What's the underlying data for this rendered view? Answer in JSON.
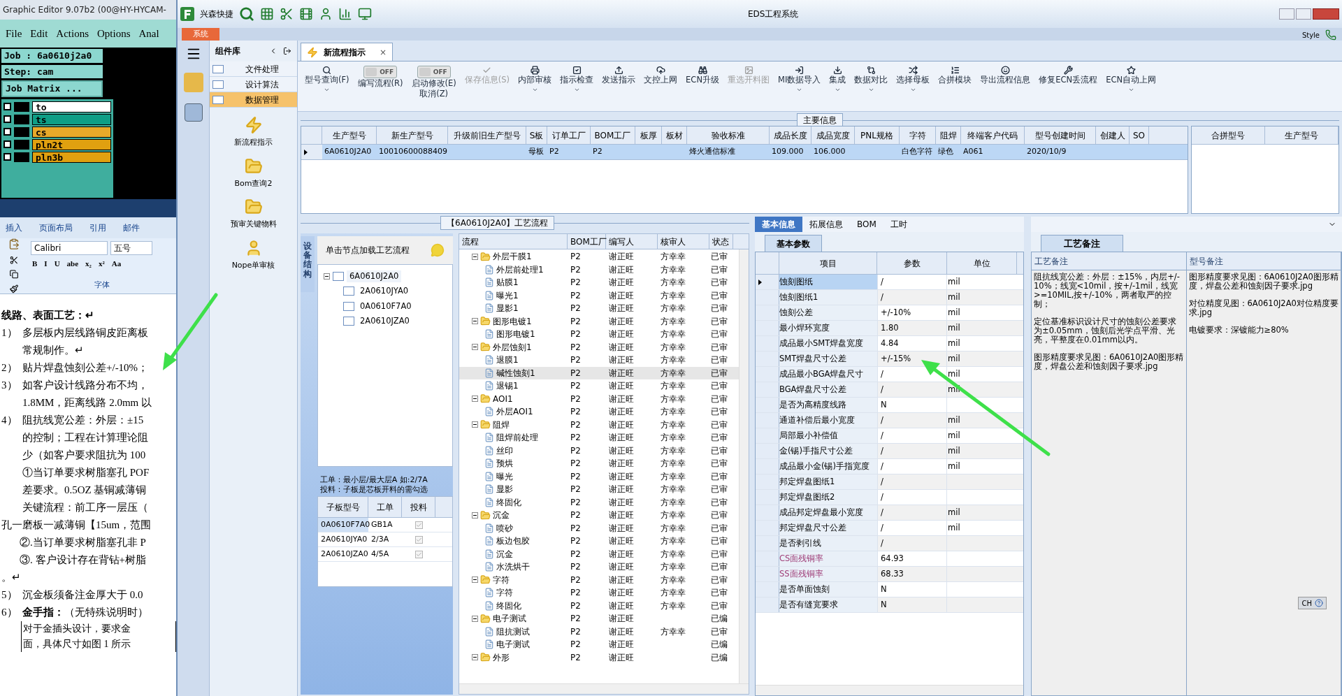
{
  "graphic_editor": {
    "title": "Graphic Editor 9.07b2 (00@HY-HYCAM-",
    "menu": [
      "File",
      "Edit",
      "Actions",
      "Options",
      "Anal"
    ],
    "job": "Job : 6a0610j2a0",
    "step": "Step: cam",
    "matrix_button": "Job Matrix ...",
    "layers": [
      {
        "name": "to",
        "color": "#ffffff",
        "checked": false
      },
      {
        "name": "ts",
        "color": "#0f9e86",
        "checked": false
      },
      {
        "name": "cs",
        "color": "#e8a92a",
        "checked": false
      },
      {
        "name": "pln2t",
        "color": "#e0a010",
        "checked": false
      },
      {
        "name": "pln3b",
        "color": "#e0a010",
        "checked": false
      }
    ]
  },
  "word": {
    "ribbon_tabs": [
      "插入",
      "页面布局",
      "引用",
      "邮件"
    ],
    "font": "Calibri",
    "size": "五号",
    "format_buttons": [
      "B",
      "I",
      "U",
      "abe",
      "x₂",
      "x²",
      "Aa"
    ],
    "group_label": "字体",
    "lines": [
      {
        "kind": "heading",
        "text": "线路、表面工艺：↵"
      },
      {
        "kind": "item",
        "num": "1）",
        "text": "多层板内层线路铜皮距离板"
      },
      {
        "kind": "cont",
        "text": "常规制作。↵"
      },
      {
        "kind": "item",
        "num": "2）",
        "text": "贴片焊盘蚀刻公差+/-10%；"
      },
      {
        "kind": "item",
        "num": "3）",
        "text": "如客户设计线路分布不均，"
      },
      {
        "kind": "cont",
        "text": "1.8MM，距离线路 2.0mm 以"
      },
      {
        "kind": "item",
        "num": "4）",
        "text": "阻抗线宽公差：外层：±15"
      },
      {
        "kind": "cont",
        "text": "的控制；工程在计算理论阻"
      },
      {
        "kind": "cont",
        "text": "少（如客户要求阻抗为 100"
      },
      {
        "kind": "cont",
        "text": "①当订单要求树脂塞孔 POF"
      },
      {
        "kind": "cont",
        "text": "差要求。0.5OZ 基铜减薄铜"
      },
      {
        "kind": "cont",
        "text": "关键流程：前工序一层压（"
      },
      {
        "kind": "flush",
        "text": "孔一磨板一减薄铜【15um，范围"
      },
      {
        "kind": "sub",
        "text": "②.当订单要求树脂塞孔非 P"
      },
      {
        "kind": "sub",
        "text": "③. 客户设计存在背钻+树脂"
      },
      {
        "kind": "flush",
        "text": "。↵"
      },
      {
        "kind": "item",
        "num": "5）",
        "text": "沉金板须备注金厚大于 0.0"
      },
      {
        "kind": "item",
        "num": "6）",
        "text": "**金手指：**（无特殊说明时）"
      },
      {
        "kind": "table",
        "text": "对于金插头设计，要求金"
      },
      {
        "kind": "table",
        "text": "面，具体尺寸如图 1 所示"
      }
    ]
  },
  "window": {
    "brand": "兴森快捷",
    "title": "EDS工程系统",
    "style": "Style",
    "system_tab": "系统"
  },
  "component_library": {
    "title": "组件库",
    "items": [
      {
        "label": "文件处理",
        "selected": false
      },
      {
        "label": "设计算法",
        "selected": false
      },
      {
        "label": "数据管理",
        "selected": true
      }
    ],
    "tools": [
      "新流程指示",
      "Bom查询2",
      "预审关键物料",
      "Nope单审核"
    ]
  },
  "doc_tab": {
    "label": "新流程指示",
    "close": "×"
  },
  "toolbar": [
    {
      "kind": "button",
      "labels": [
        "型号查询(F)"
      ],
      "dropdown": true,
      "disabled": false
    },
    {
      "kind": "toggle",
      "state": "OFF",
      "on": false,
      "labels": [
        "编写流程(R)"
      ],
      "dropdown": false,
      "disabled": false
    },
    {
      "kind": "toggle",
      "state": "OFF",
      "on": false,
      "labels": [
        "启动修改(E)",
        "取消(Z)"
      ],
      "dropdown": false,
      "disabled": false
    },
    {
      "kind": "button",
      "labels": [
        "保存信息(S)"
      ],
      "dropdown": false,
      "disabled": true
    },
    {
      "kind": "button",
      "labels": [
        "内部审核"
      ],
      "dropdown": true,
      "disabled": false
    },
    {
      "kind": "button",
      "labels": [
        "指示检查"
      ],
      "dropdown": true,
      "disabled": false
    },
    {
      "kind": "button",
      "labels": [
        "发送指示"
      ],
      "dropdown": false,
      "disabled": false
    },
    {
      "kind": "button",
      "labels": [
        "文控上网"
      ],
      "dropdown": false,
      "disabled": false
    },
    {
      "kind": "button",
      "labels": [
        "ECN升级"
      ],
      "dropdown": false,
      "disabled": false
    },
    {
      "kind": "button",
      "labels": [
        "重选开料图"
      ],
      "dropdown": false,
      "disabled": true
    },
    {
      "kind": "button",
      "labels": [
        "MI数据导入"
      ],
      "dropdown": true,
      "disabled": false
    },
    {
      "kind": "button",
      "labels": [
        "集成"
      ],
      "dropdown": true,
      "disabled": false
    },
    {
      "kind": "button",
      "labels": [
        "数据对比"
      ],
      "dropdown": true,
      "disabled": false
    },
    {
      "kind": "button",
      "labels": [
        "选择母板"
      ],
      "dropdown": true,
      "disabled": false
    },
    {
      "kind": "button",
      "labels": [
        "合拼模块"
      ],
      "dropdown": false,
      "disabled": false
    },
    {
      "kind": "button",
      "labels": [
        "导出流程信息"
      ],
      "dropdown": false,
      "disabled": false
    },
    {
      "kind": "button",
      "labels": [
        "修复ECN丢流程"
      ],
      "dropdown": false,
      "disabled": false
    },
    {
      "kind": "button",
      "labels": [
        "ECN自动上网"
      ],
      "dropdown": true,
      "disabled": false
    }
  ],
  "main_info": {
    "legend": "主要信息",
    "columns": [
      "生产型号",
      "新生产型号",
      "升级前旧生产型号",
      "S板",
      "订单工厂",
      "BOM工厂",
      "板厚",
      "板材",
      "验收标准",
      "成品长度",
      "成品宽度",
      "PNL规格",
      "字符",
      "阻焊",
      "终端客户代码",
      "型号创建时间",
      "创建人",
      "SO"
    ],
    "rows": [
      {
        "selected": true,
        "cells": [
          "6A0610J2A0",
          "10010600088409",
          "",
          "母板",
          "P2",
          "P2",
          "",
          "",
          "烽火通信标准",
          "109.000",
          "106.000",
          "",
          "白色字符",
          "绿色",
          "A061",
          "2020/10/9",
          "",
          ""
        ]
      }
    ],
    "side_columns": [
      "合拼型号",
      "生产型号"
    ]
  },
  "process": {
    "legend": "【6A0610J2A0】工艺流程",
    "side_tab": "设备结构",
    "hint": "单击节点加载工艺流程",
    "tree": [
      {
        "name": "6A0610J2A0",
        "expanded": true,
        "children": [
          {
            "name": "2A0610JYA0"
          },
          {
            "name": "0A0610F7A0"
          },
          {
            "name": "2A0610JZA0"
          }
        ]
      }
    ],
    "note_lines": [
      "工单：最小层/最大层A 如:2/7A",
      "投料：子板是芯板开料的需勾选"
    ],
    "subboard_columns": [
      "子板型号",
      "工单",
      "投料"
    ],
    "subboards": [
      {
        "model": "0A0610F7A0",
        "order": "GB1A",
        "checked": true,
        "selected": true
      },
      {
        "model": "2A0610JYA0",
        "order": "2/3A",
        "checked": true,
        "selected": false
      },
      {
        "model": "2A0610JZA0",
        "order": "4/5A",
        "checked": true,
        "selected": false
      }
    ],
    "grid_columns": [
      "流程",
      "BOM工厂",
      "编写人",
      "核审人",
      "状态"
    ],
    "steps": [
      {
        "name": "外层干膜1",
        "bom": "P2",
        "writer": "谢正旺",
        "reviewer": "方幸幸",
        "status": "已审",
        "expanded": true,
        "selected": false,
        "children": [
          {
            "name": "外层前处理1",
            "bom": "P2",
            "writer": "谢正旺",
            "reviewer": "方幸幸",
            "status": "已审",
            "selected": false
          },
          {
            "name": "贴膜1",
            "bom": "P2",
            "writer": "谢正旺",
            "reviewer": "方幸幸",
            "status": "已审",
            "selected": false
          },
          {
            "name": "曝光1",
            "bom": "P2",
            "writer": "谢正旺",
            "reviewer": "方幸幸",
            "status": "已审",
            "selected": false
          },
          {
            "name": "显影1",
            "bom": "P2",
            "writer": "谢正旺",
            "reviewer": "方幸幸",
            "status": "已审",
            "selected": false
          }
        ]
      },
      {
        "name": "图形电镀1",
        "bom": "P2",
        "writer": "谢正旺",
        "reviewer": "方幸幸",
        "status": "已审",
        "expanded": true,
        "selected": false,
        "children": [
          {
            "name": "图形电镀1",
            "bom": "P2",
            "writer": "谢正旺",
            "reviewer": "方幸幸",
            "status": "已审",
            "selected": false
          }
        ]
      },
      {
        "name": "外层蚀刻1",
        "bom": "P2",
        "writer": "谢正旺",
        "reviewer": "方幸幸",
        "status": "已审",
        "expanded": true,
        "selected": false,
        "children": [
          {
            "name": "退膜1",
            "bom": "P2",
            "writer": "谢正旺",
            "reviewer": "方幸幸",
            "status": "已审",
            "selected": false
          },
          {
            "name": "碱性蚀刻1",
            "bom": "P2",
            "writer": "谢正旺",
            "reviewer": "方幸幸",
            "status": "已审",
            "selected": true
          },
          {
            "name": "退锡1",
            "bom": "P2",
            "writer": "谢正旺",
            "reviewer": "方幸幸",
            "status": "已审",
            "selected": false
          }
        ]
      },
      {
        "name": "AOI1",
        "bom": "P2",
        "writer": "谢正旺",
        "reviewer": "方幸幸",
        "status": "已审",
        "expanded": true,
        "selected": false,
        "children": [
          {
            "name": "外层AOI1",
            "bom": "P2",
            "writer": "谢正旺",
            "reviewer": "方幸幸",
            "status": "已审",
            "selected": false
          }
        ]
      },
      {
        "name": "阻焊",
        "bom": "P2",
        "writer": "谢正旺",
        "reviewer": "方幸幸",
        "status": "已审",
        "expanded": true,
        "selected": false,
        "children": [
          {
            "name": "阻焊前处理",
            "bom": "P2",
            "writer": "谢正旺",
            "reviewer": "方幸幸",
            "status": "已审",
            "selected": false
          },
          {
            "name": "丝印",
            "bom": "P2",
            "writer": "谢正旺",
            "reviewer": "方幸幸",
            "status": "已审",
            "selected": false
          },
          {
            "name": "预烘",
            "bom": "P2",
            "writer": "谢正旺",
            "reviewer": "方幸幸",
            "status": "已审",
            "selected": false
          },
          {
            "name": "曝光",
            "bom": "P2",
            "writer": "谢正旺",
            "reviewer": "方幸幸",
            "status": "已审",
            "selected": false
          },
          {
            "name": "显影",
            "bom": "P2",
            "writer": "谢正旺",
            "reviewer": "方幸幸",
            "status": "已审",
            "selected": false
          },
          {
            "name": "终固化",
            "bom": "P2",
            "writer": "谢正旺",
            "reviewer": "方幸幸",
            "status": "已审",
            "selected": false
          }
        ]
      },
      {
        "name": "沉金",
        "bom": "P2",
        "writer": "谢正旺",
        "reviewer": "方幸幸",
        "status": "已审",
        "expanded": true,
        "selected": false,
        "children": [
          {
            "name": "喷砂",
            "bom": "P2",
            "writer": "谢正旺",
            "reviewer": "方幸幸",
            "status": "已审",
            "selected": false
          },
          {
            "name": "板边包胶",
            "bom": "P2",
            "writer": "谢正旺",
            "reviewer": "方幸幸",
            "status": "已审",
            "selected": false
          },
          {
            "name": "沉金",
            "bom": "P2",
            "writer": "谢正旺",
            "reviewer": "方幸幸",
            "status": "已审",
            "selected": false
          },
          {
            "name": "水洗烘干",
            "bom": "P2",
            "writer": "谢正旺",
            "reviewer": "方幸幸",
            "status": "已审",
            "selected": false
          }
        ]
      },
      {
        "name": "字符",
        "bom": "P2",
        "writer": "谢正旺",
        "reviewer": "方幸幸",
        "status": "已审",
        "expanded": true,
        "selected": false,
        "children": [
          {
            "name": "字符",
            "bom": "P2",
            "writer": "谢正旺",
            "reviewer": "方幸幸",
            "status": "已审",
            "selected": false
          },
          {
            "name": "终固化",
            "bom": "P2",
            "writer": "谢正旺",
            "reviewer": "方幸幸",
            "status": "已审",
            "selected": false
          }
        ]
      },
      {
        "name": "电子测试",
        "bom": "P2",
        "writer": "谢正旺",
        "status": "已编",
        "expanded": true,
        "selected": false,
        "children": [
          {
            "name": "阻抗测试",
            "bom": "P2",
            "writer": "谢正旺",
            "reviewer": "方幸幸",
            "status": "已审",
            "selected": false
          },
          {
            "name": "电子测试",
            "bom": "P2",
            "writer": "谢正旺",
            "status": "已编",
            "selected": false
          }
        ]
      },
      {
        "name": "外形",
        "bom": "P2",
        "writer": "谢正旺",
        "status": "已编",
        "expanded": true,
        "selected": false
      }
    ]
  },
  "info_tabs": [
    {
      "label": "基本信息",
      "selected": true
    },
    {
      "label": "拓展信息",
      "selected": false
    },
    {
      "label": "BOM",
      "selected": false
    },
    {
      "label": "工时",
      "selected": false
    }
  ],
  "params": {
    "tab": "基本参数",
    "columns": [
      "项目",
      "参数",
      "单位"
    ],
    "rows": [
      {
        "item": "蚀刻图纸",
        "value": "/",
        "unit": "mil",
        "highlighted": false,
        "selected": true
      },
      {
        "item": "蚀刻图纸1",
        "value": "/",
        "unit": "mil",
        "highlighted": false,
        "selected": false
      },
      {
        "item": "蚀刻公差",
        "value": "+/-10%",
        "unit": "mil",
        "highlighted": false,
        "selected": false
      },
      {
        "item": "最小焊环宽度",
        "value": "1.80",
        "unit": "mil",
        "highlighted": false,
        "selected": false
      },
      {
        "item": "成品最小SMT焊盘宽度",
        "value": "4.84",
        "unit": "mil",
        "highlighted": false,
        "selected": false
      },
      {
        "item": "SMT焊盘尺寸公差",
        "value": "+/-15%",
        "unit": "mil",
        "highlighted": false,
        "selected": false
      },
      {
        "item": "成品最小BGA焊盘尺寸",
        "value": "/",
        "unit": "mil",
        "highlighted": false,
        "selected": false
      },
      {
        "item": "BGA焊盘尺寸公差",
        "value": "/",
        "unit": "mil",
        "highlighted": false,
        "selected": false
      },
      {
        "item": "是否为高精度线路",
        "value": "N",
        "highlighted": false,
        "selected": false
      },
      {
        "item": "通道补偿后最小宽度",
        "value": "/",
        "unit": "mil",
        "highlighted": false,
        "selected": false
      },
      {
        "item": "局部最小补偿值",
        "value": "/",
        "unit": "mil",
        "highlighted": false,
        "selected": false
      },
      {
        "item": "金(锡)手指尺寸公差",
        "value": "/",
        "unit": "mil",
        "highlighted": false,
        "selected": false
      },
      {
        "item": "成品最小金(锡)手指宽度",
        "value": "/",
        "unit": "mil",
        "highlighted": false,
        "selected": false
      },
      {
        "item": "邦定焊盘图纸1",
        "value": "/",
        "highlighted": false,
        "selected": false
      },
      {
        "item": "邦定焊盘图纸2",
        "value": "/",
        "highlighted": false,
        "selected": false
      },
      {
        "item": "成品邦定焊盘最小宽度",
        "value": "/",
        "unit": "mil",
        "highlighted": false,
        "selected": false
      },
      {
        "item": "邦定焊盘尺寸公差",
        "value": "/",
        "unit": "mil",
        "highlighted": false,
        "selected": false
      },
      {
        "item": "是否剥引线",
        "value": "/",
        "highlighted": false,
        "selected": false
      },
      {
        "item": "CS面残铜率",
        "value": "64.93",
        "highlighted": true,
        "selected": false
      },
      {
        "item": "SS面残铜率",
        "value": "68.33",
        "highlighted": true,
        "selected": false
      },
      {
        "item": "是否单面蚀刻",
        "value": "N",
        "highlighted": false,
        "selected": false
      },
      {
        "item": "是否有缝宽要求",
        "value": "N",
        "highlighted": false,
        "selected": false
      }
    ]
  },
  "notes": {
    "tab": "工艺备注",
    "columns": [
      "工艺备注",
      "型号备注"
    ],
    "process_notes": [
      "阻抗线宽公差：外层：±15%，内层+/-10%；线宽<10mil，按+/-1mil，线宽>=10MIL,按+/-10%，两者取严的控制；",
      "定位基准标识设计尺寸的蚀刻公差要求为±0.05mm，蚀刻后光学点平滑、光亮，平整度在0.01mm以内。",
      "图形精度要求见图：6A0610J2A0图形精度，焊盘公差和蚀刻因子要求.jpg"
    ],
    "model_notes": [
      "图形精度要求见图：6A0610J2A0图形精度，焊盘公差和蚀刻因子要求.jpg",
      "对位精度见图：6A0610J2A0对位精度要求.jpg",
      "电镀要求：深镀能力≥80%"
    ]
  },
  "language_bar": "CH"
}
